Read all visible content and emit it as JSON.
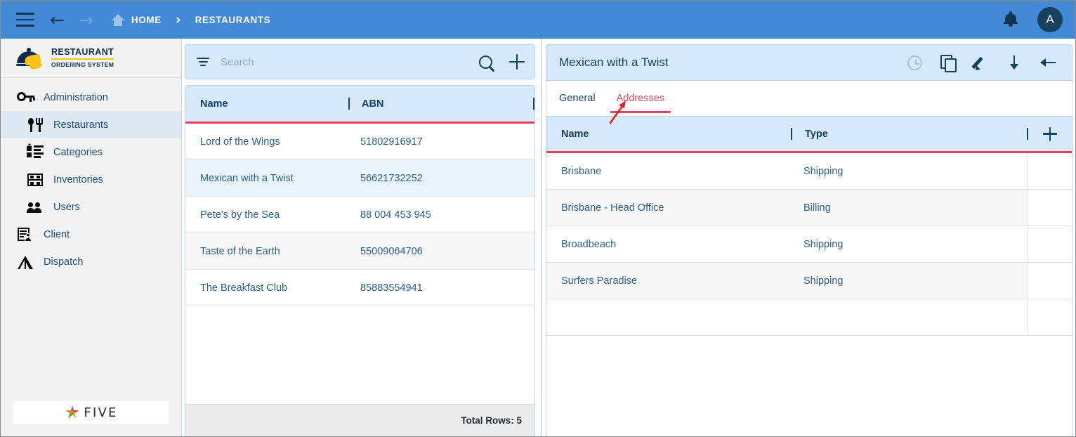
{
  "topbar": {
    "menu_icon": "hamburger-icon",
    "back_icon": "arrow-left-icon",
    "forward_icon": "arrow-right-icon",
    "home_icon": "home-icon",
    "home_label": "HOME",
    "separator": "›",
    "current_label": "RESTAURANTS",
    "bell_icon": "bell-icon",
    "avatar_initial": "A",
    "bg_color": "#4289d6"
  },
  "sidebar": {
    "logo": {
      "line1": "RESTAURANT",
      "line2": "ORDERING SYSTEM",
      "mark_icon": "food-dome-hand-icon",
      "accent_color": "#f9c317",
      "dark_color": "#112b44"
    },
    "items": [
      {
        "label": "Administration",
        "icon": "key-icon",
        "level": 1,
        "active": false
      },
      {
        "label": "Restaurants",
        "icon": "fork-spoon-icon",
        "level": 2,
        "active": true
      },
      {
        "label": "Categories",
        "icon": "list-bullets-icon",
        "level": 2,
        "active": false
      },
      {
        "label": "Inventories",
        "icon": "shelf-icon",
        "level": 2,
        "active": false
      },
      {
        "label": "Users",
        "icon": "users-icon",
        "level": 2,
        "active": false
      },
      {
        "label": "Client",
        "icon": "client-form-icon",
        "level": 1,
        "active": false
      },
      {
        "label": "Dispatch",
        "icon": "compass-triangle-icon",
        "level": 1,
        "active": false
      }
    ],
    "footer_logo": {
      "word": "FIVE",
      "mark_icon": "five-star-icon",
      "colors": [
        "#3d82e0",
        "#e03c31",
        "#f6b41e",
        "#35a853",
        "#f07c1e"
      ]
    }
  },
  "list_panel": {
    "search": {
      "placeholder": "Search",
      "value": "",
      "filter_icon": "filter-icon",
      "search_icon": "search-icon",
      "add_icon": "plus-icon"
    },
    "columns": [
      "Name",
      "ABN"
    ],
    "rows": [
      {
        "name": "Lord of the Wings",
        "abn": "51802916917",
        "selected": false
      },
      {
        "name": "Mexican with a Twist",
        "abn": "56621732252",
        "selected": true
      },
      {
        "name": "Pete's by the Sea",
        "abn": "88 004 453 945",
        "selected": false
      },
      {
        "name": "Taste of the Earth",
        "abn": "55009064706",
        "selected": false
      },
      {
        "name": "The Breakfast Club",
        "abn": "85883554941",
        "selected": false
      }
    ],
    "footer_total": "Total Rows: 5",
    "header_bg": "#d6e9fa",
    "header_underline": "#e8415e"
  },
  "detail_panel": {
    "title": "Mexican with a Twist",
    "toolbar": [
      {
        "name": "history-icon",
        "label": "History",
        "disabled": true
      },
      {
        "name": "copy-icon",
        "label": "Copy",
        "disabled": false
      },
      {
        "name": "edit-pencil-icon",
        "label": "Edit",
        "disabled": false
      },
      {
        "name": "download-icon",
        "label": "Download",
        "disabled": false
      },
      {
        "name": "arrow-left-icon",
        "label": "Back",
        "disabled": false
      }
    ],
    "tabs": [
      {
        "label": "General",
        "active": false
      },
      {
        "label": "Addresses",
        "active": true
      }
    ],
    "active_tab_color": "#f0465f",
    "columns": [
      "Name",
      "Type"
    ],
    "add_icon": "plus-icon",
    "rows": [
      {
        "name": "Brisbane",
        "type": "Shipping"
      },
      {
        "name": "Brisbane - Head Office",
        "type": "Billing"
      },
      {
        "name": "Broadbeach",
        "type": "Shipping"
      },
      {
        "name": "Surfers Paradise",
        "type": "Shipping"
      }
    ]
  },
  "annotation": {
    "arrow_icon": "red-arrow-annotation",
    "color": "#ee1c1c",
    "points_to": "Addresses"
  }
}
